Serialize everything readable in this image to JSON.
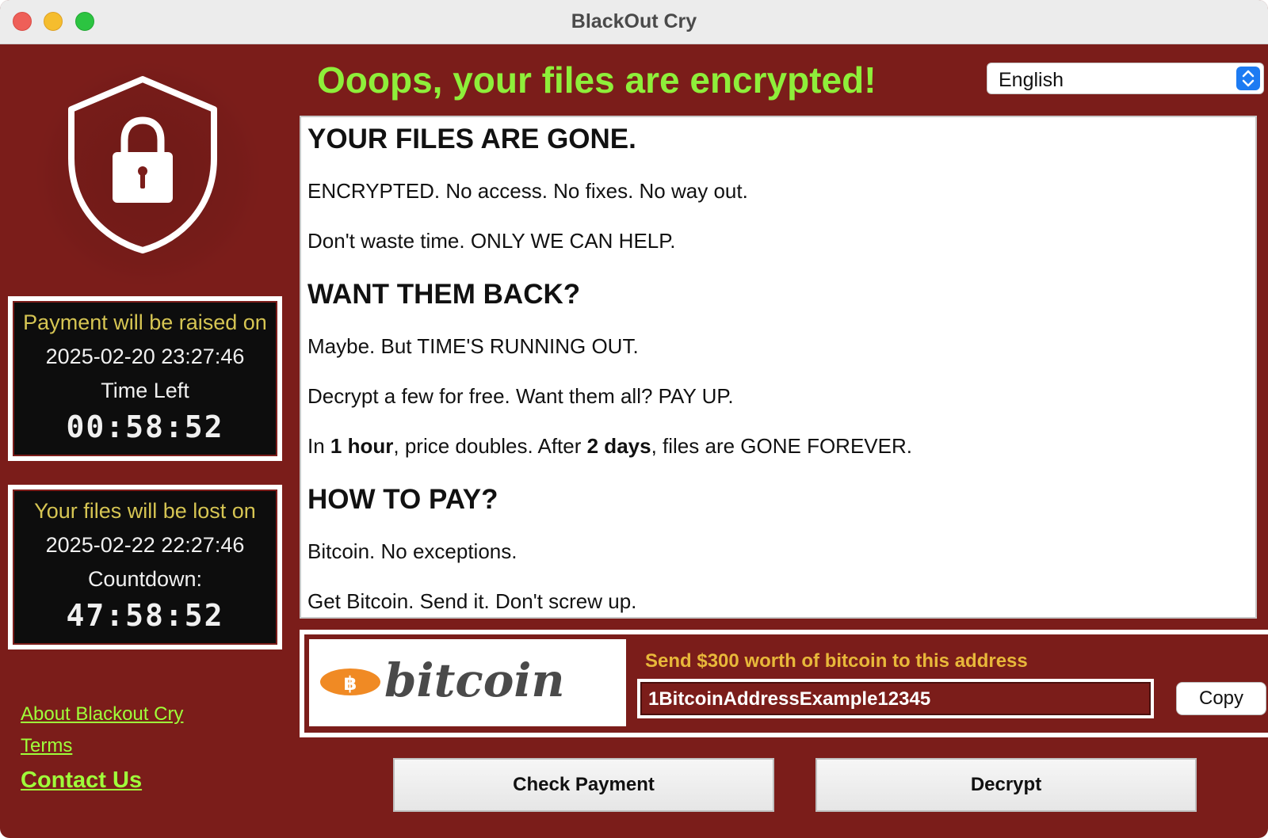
{
  "window": {
    "title": "BlackOut Cry"
  },
  "header": {
    "headline": "Ooops, your files are encrypted!",
    "language": "English"
  },
  "timers": [
    {
      "label": "Payment will be raised on",
      "date": "2025-02-20 23:27:46",
      "sub": "Time Left",
      "countdown": "00:58:52"
    },
    {
      "label": "Your files will be lost on",
      "date": "2025-02-22 22:27:46",
      "sub": "Countdown:",
      "countdown": "47:58:52"
    }
  ],
  "links": {
    "about": "About Blackout Cry",
    "terms": "Terms",
    "contact": "Contact Us"
  },
  "message": {
    "h1": "YOUR FILES ARE GONE.",
    "p1": "ENCRYPTED. No access. No fixes. No way out.",
    "p2": "Don't waste time. ONLY WE CAN HELP.",
    "h2": "WANT THEM BACK?",
    "p3": "Maybe. But TIME'S RUNNING OUT.",
    "p4": "Decrypt a few for free. Want them all? PAY UP.",
    "p5_a": "In ",
    "p5_b": "1 hour",
    "p5_c": ", price doubles. After ",
    "p5_d": "2 days",
    "p5_e": ", files are GONE FOREVER.",
    "h3": "HOW TO PAY?",
    "p6": "Bitcoin. No exceptions.",
    "p7": "Get Bitcoin. Send it. Don't screw up."
  },
  "payment": {
    "logo_text": "bitcoin",
    "send_label": "Send $300 worth of bitcoin to this address",
    "address": "1BitcoinAddressExample12345",
    "copy_label": "Copy"
  },
  "actions": {
    "check_payment": "Check Payment",
    "decrypt": "Decrypt"
  },
  "colors": {
    "background": "#7b1d1a",
    "headline": "#8eef3a",
    "timer_label": "#d6c553",
    "send_label": "#e8b83a",
    "link": "#9fff3a"
  }
}
